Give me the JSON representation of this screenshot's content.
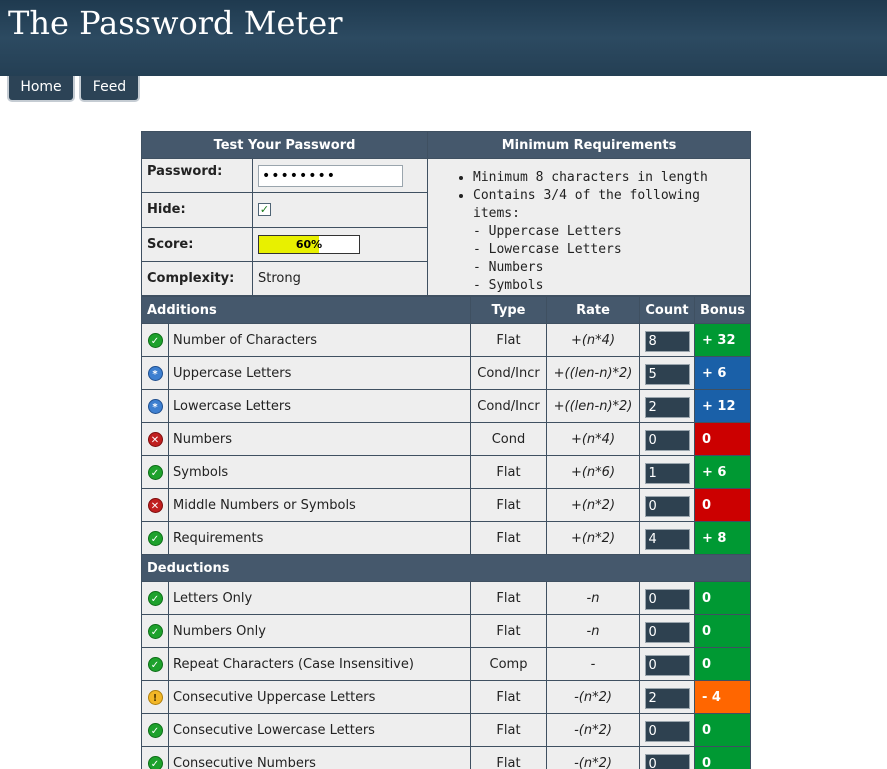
{
  "site_title": "The Password Meter",
  "nav": {
    "home_label": "Home",
    "feed_label": "Feed"
  },
  "test_panel": {
    "heading": "Test Your Password",
    "password_label": "Password:",
    "password_value": "••••••••",
    "hide_label": "Hide:",
    "hide_checked": true,
    "hide_check_glyph": "✓",
    "score_label": "Score:",
    "score_text": "60%",
    "score_fraction": 0.6,
    "score_color": "#e8f000",
    "complexity_label": "Complexity:",
    "complexity_value": "Strong"
  },
  "requirements": {
    "heading": "Minimum Requirements",
    "items": [
      "Minimum 8 characters in length",
      "Contains 3/4 of the following items:"
    ],
    "subitems": [
      "- Uppercase Letters",
      "- Lowercase Letters",
      "- Numbers",
      "- Symbols"
    ]
  },
  "columns": {
    "additions": "Additions",
    "deductions": "Deductions",
    "type": "Type",
    "rate": "Rate",
    "count": "Count",
    "bonus": "Bonus"
  },
  "status_colors": {
    "pass": "#009933",
    "exceed": "#1a60a8",
    "fail": "#cc0000",
    "warn": "#ff6600"
  },
  "additions": [
    {
      "icon": "pass",
      "name": "Number of Characters",
      "type": "Flat",
      "rate": "+(n*4)",
      "count": "8",
      "bonus": "+ 32",
      "bonus_status": "pass"
    },
    {
      "icon": "exceed",
      "name": "Uppercase Letters",
      "type": "Cond/Incr",
      "rate": "+((len-n)*2)",
      "count": "5",
      "bonus": "+ 6",
      "bonus_status": "exceed"
    },
    {
      "icon": "exceed",
      "name": "Lowercase Letters",
      "type": "Cond/Incr",
      "rate": "+((len-n)*2)",
      "count": "2",
      "bonus": "+ 12",
      "bonus_status": "exceed"
    },
    {
      "icon": "fail",
      "name": "Numbers",
      "type": "Cond",
      "rate": "+(n*4)",
      "count": "0",
      "bonus": "0",
      "bonus_status": "fail"
    },
    {
      "icon": "pass",
      "name": "Symbols",
      "type": "Flat",
      "rate": "+(n*6)",
      "count": "1",
      "bonus": "+ 6",
      "bonus_status": "pass"
    },
    {
      "icon": "fail",
      "name": "Middle Numbers or Symbols",
      "type": "Flat",
      "rate": "+(n*2)",
      "count": "0",
      "bonus": "0",
      "bonus_status": "fail"
    },
    {
      "icon": "pass",
      "name": "Requirements",
      "type": "Flat",
      "rate": "+(n*2)",
      "count": "4",
      "bonus": "+ 8",
      "bonus_status": "pass"
    }
  ],
  "deductions": [
    {
      "icon": "pass",
      "name": "Letters Only",
      "type": "Flat",
      "rate": "-n",
      "count": "0",
      "bonus": "0",
      "bonus_status": "pass"
    },
    {
      "icon": "pass",
      "name": "Numbers Only",
      "type": "Flat",
      "rate": "-n",
      "count": "0",
      "bonus": "0",
      "bonus_status": "pass"
    },
    {
      "icon": "pass",
      "name": "Repeat Characters (Case Insensitive)",
      "type": "Comp",
      "rate": "-",
      "count": "0",
      "bonus": "0",
      "bonus_status": "pass"
    },
    {
      "icon": "warn",
      "name": "Consecutive Uppercase Letters",
      "type": "Flat",
      "rate": "-(n*2)",
      "count": "2",
      "bonus": "- 4",
      "bonus_status": "warn"
    },
    {
      "icon": "pass",
      "name": "Consecutive Lowercase Letters",
      "type": "Flat",
      "rate": "-(n*2)",
      "count": "0",
      "bonus": "0",
      "bonus_status": "pass"
    },
    {
      "icon": "pass",
      "name": "Consecutive Numbers",
      "type": "Flat",
      "rate": "-(n*2)",
      "count": "0",
      "bonus": "0",
      "bonus_status": "pass"
    }
  ],
  "icon_glyphs": {
    "pass": "✓",
    "exceed": "*",
    "fail": "✕",
    "warn": "!"
  },
  "icon_names": {
    "pass": "check-circle-icon",
    "exceed": "asterisk-circle-icon",
    "fail": "x-circle-icon",
    "warn": "exclamation-circle-icon"
  }
}
